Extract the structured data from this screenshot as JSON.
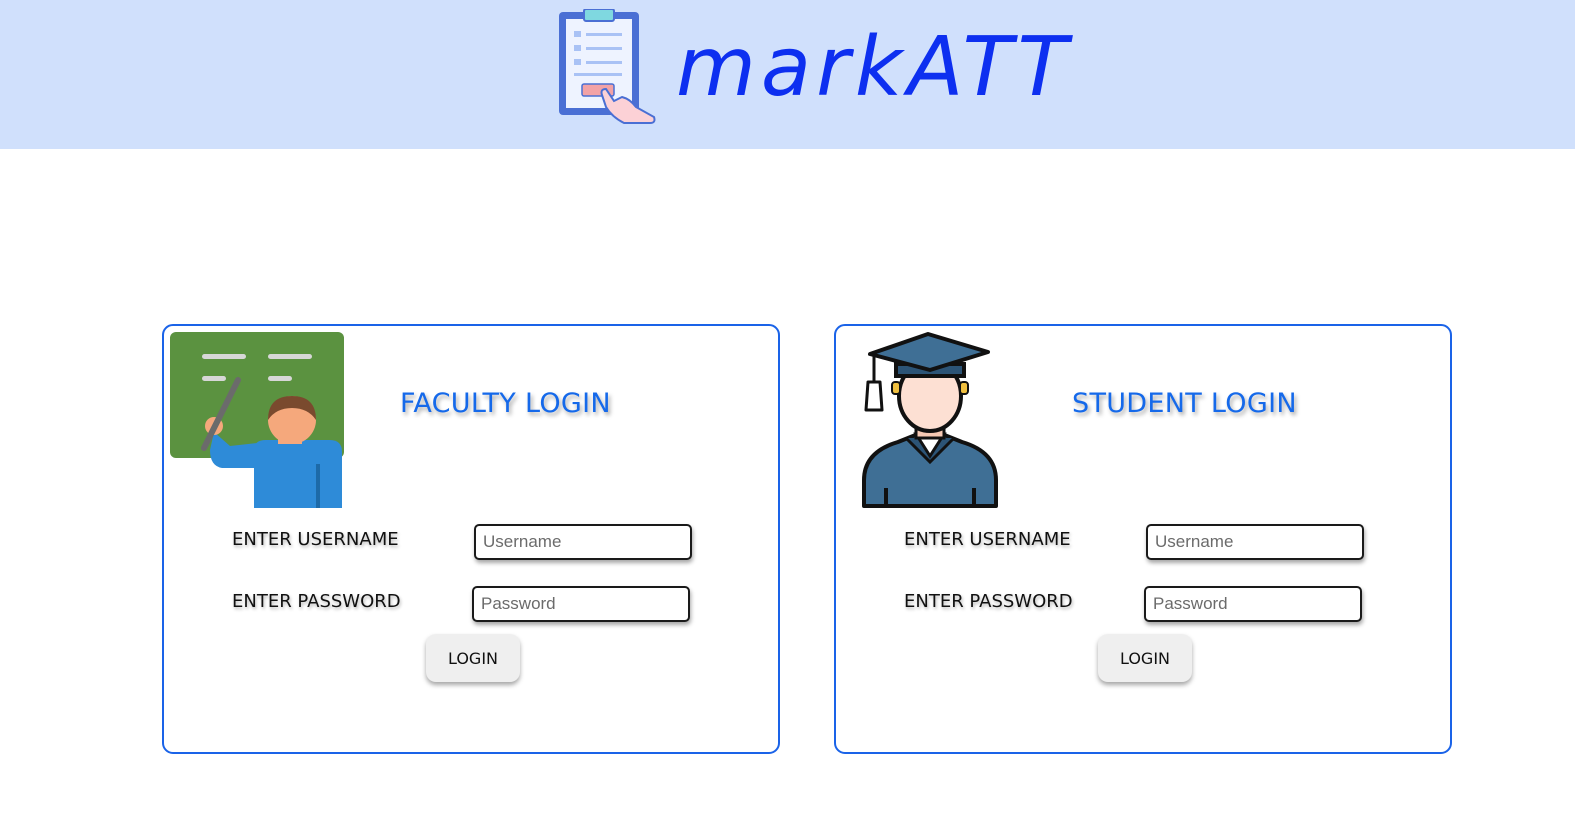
{
  "header": {
    "brand": "markATT",
    "logo_icon": "clipboard-click-icon",
    "background": "#d0e0fc",
    "brand_color": "#0d2ff0"
  },
  "faculty": {
    "title": "FACULTY LOGIN",
    "illustration": "teacher-blackboard-icon",
    "username_label": "ENTER USERNAME",
    "username_placeholder": "Username",
    "password_label": "ENTER PASSWORD",
    "password_placeholder": "Password",
    "login_label": "LOGIN"
  },
  "student": {
    "title": "STUDENT LOGIN",
    "illustration": "graduate-student-icon",
    "username_label": "ENTER USERNAME",
    "username_placeholder": "Username",
    "password_label": "ENTER PASSWORD",
    "password_placeholder": "Password",
    "login_label": "LOGIN"
  },
  "colors": {
    "accent": "#1569ea",
    "card_border": "#1a63e8"
  }
}
